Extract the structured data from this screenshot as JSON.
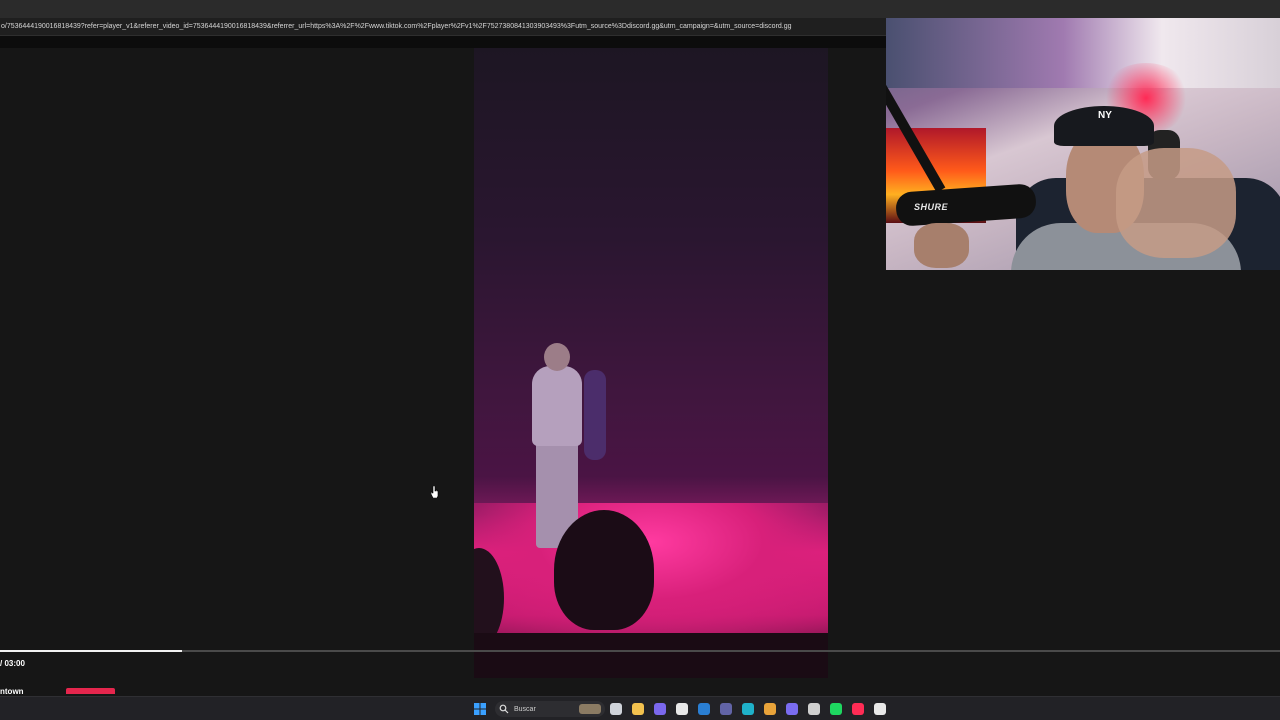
{
  "browser": {
    "url": "o/7536444190016818439?refer=player_v1&referer_video_id=7536444190016818439&referrer_url=https%3A%2F%2Fwww.tiktok.com%2Fplayer%2Fv1%2F7527380841303903493%3Futm_source%3Ddiscord.gg&utm_campaign=&utm_source=discord.gg"
  },
  "player": {
    "time_display": "/ 03:00",
    "channel_name": "ntown",
    "progress_fraction": 0.142
  },
  "webcam": {
    "mic_brand": "SHURE",
    "cap_logo": "NY"
  },
  "taskbar": {
    "search_placeholder": "Buscar",
    "apps": [
      {
        "icon": "windows-start-icon",
        "color": "#3aa0ff"
      },
      {
        "icon": "task-view-icon",
        "color": "#cfd3da"
      },
      {
        "icon": "file-explorer-icon",
        "color": "#f2c14e"
      },
      {
        "icon": "copilot-icon",
        "color": "#7b68ee"
      },
      {
        "icon": "store-icon",
        "color": "#e8e8e8"
      },
      {
        "icon": "outlook-icon",
        "color": "#2a7fd4"
      },
      {
        "icon": "teams-icon",
        "color": "#6264a7"
      },
      {
        "icon": "edge-icon",
        "color": "#1fb1c9"
      },
      {
        "icon": "chrome-icon",
        "color": "#e8a33a"
      },
      {
        "icon": "discord-icon",
        "color": "#7a6cf0"
      },
      {
        "icon": "settings-icon",
        "color": "#cfcfcf"
      },
      {
        "icon": "spotify-icon",
        "color": "#1ed760"
      },
      {
        "icon": "tiktok-icon",
        "color": "#ff2c55"
      },
      {
        "icon": "back-icon",
        "color": "#e8e8e8"
      }
    ]
  }
}
